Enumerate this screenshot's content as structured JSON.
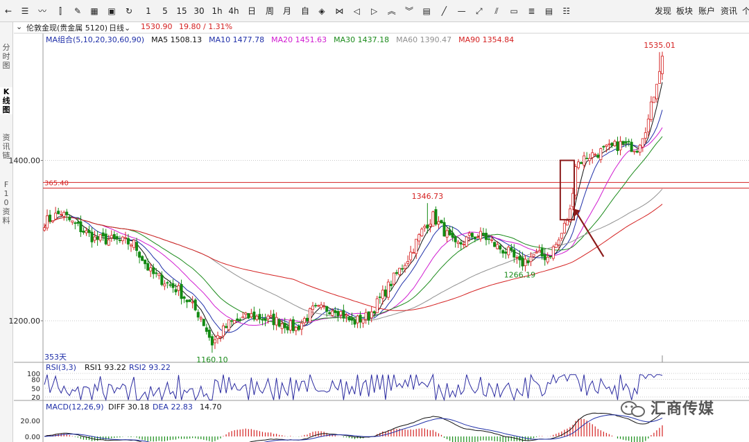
{
  "toolbar": {
    "left_icons": [
      "back-icon",
      "list-icon",
      "line-chart-icon",
      "candlestick-icon",
      "draw-icon",
      "grid-icon",
      "save-icon",
      "refresh-icon"
    ],
    "periods": [
      "1",
      "5",
      "15",
      "30",
      "1h",
      "4h",
      "日",
      "周",
      "月",
      "自"
    ],
    "tool_icons": [
      "diamond-icon",
      "bowtie-icon",
      "arrow-left-icon",
      "arrow-right-icon",
      "chevron-up-icon",
      "chevron-down-icon",
      "table-icon",
      "line-tool-icon",
      "hline-tool-icon",
      "ray-tool-icon",
      "parallel-tool-icon",
      "rect-tool-icon",
      "fib-tool-icon",
      "sheet-icon",
      "list-tool-icon"
    ],
    "right_links": [
      "发现",
      "板块",
      "账户",
      "资讯"
    ],
    "clipped": "个"
  },
  "sidebar": {
    "tabs": [
      "分时图",
      "K线图",
      "资讯链",
      "F10资料"
    ],
    "active": "K线图"
  },
  "info": {
    "name": "伦敦金现(贵金属 5120)",
    "period": "日线",
    "price": "1530.90",
    "change": "19.80 / 1.31%"
  },
  "ma_legend": [
    {
      "label": "MA组合(5,10,20,30,60,90)",
      "color": "#1f2fa8"
    },
    {
      "label": "MA5 1508.13",
      "color": "#111111"
    },
    {
      "label": "MA10 1477.78",
      "color": "#1f2fa8"
    },
    {
      "label": "MA20 1451.63",
      "color": "#d01ad0"
    },
    {
      "label": "MA30 1437.18",
      "color": "#1a8a1a"
    },
    {
      "label": "MA60 1390.47",
      "color": "#909090"
    },
    {
      "label": "MA90 1354.84",
      "color": "#d42020"
    }
  ],
  "chart_data": {
    "type": "candlestick",
    "y_ticks": [
      "1400.00",
      "1200.00"
    ],
    "ylim": [
      1150,
      1540
    ],
    "hlines": [
      1365.4,
      1372.5
    ],
    "hline_label": "365.40",
    "annotations": [
      {
        "text": "1535.01",
        "i": 220,
        "value": 1535.01,
        "color": "#d42020"
      },
      {
        "text": "1346.73",
        "i": 137,
        "value": 1346.73,
        "color": "#d42020"
      },
      {
        "text": "1266.19",
        "i": 170,
        "value": 1266.19,
        "color": "#1a8a1a"
      },
      {
        "text": "1160.10",
        "i": 60,
        "value": 1160.1,
        "color": "#1a8a1a"
      }
    ],
    "bar_count_label": "353天",
    "highlight_box": {
      "i0": 185,
      "i1": 189,
      "low": 1326,
      "high": 1400
    },
    "arrow": {
      "from_i": 200,
      "from_value": 1280,
      "to_i": 189,
      "to_value": 1340
    },
    "anchors": [
      [
        0,
        1323
      ],
      [
        6,
        1335
      ],
      [
        10,
        1322
      ],
      [
        18,
        1302
      ],
      [
        26,
        1300
      ],
      [
        32,
        1296
      ],
      [
        38,
        1260
      ],
      [
        48,
        1238
      ],
      [
        56,
        1205
      ],
      [
        60,
        1172
      ],
      [
        66,
        1196
      ],
      [
        74,
        1206
      ],
      [
        84,
        1199
      ],
      [
        90,
        1190
      ],
      [
        96,
        1213
      ],
      [
        104,
        1216
      ],
      [
        110,
        1198
      ],
      [
        116,
        1206
      ],
      [
        124,
        1248
      ],
      [
        130,
        1278
      ],
      [
        136,
        1318
      ],
      [
        139,
        1330
      ],
      [
        143,
        1312
      ],
      [
        147,
        1292
      ],
      [
        153,
        1306
      ],
      [
        157,
        1306
      ],
      [
        162,
        1292
      ],
      [
        166,
        1285
      ],
      [
        170,
        1270
      ],
      [
        175,
        1282
      ],
      [
        180,
        1280
      ],
      [
        184,
        1300
      ],
      [
        188,
        1336
      ],
      [
        190,
        1395
      ],
      [
        194,
        1405
      ],
      [
        200,
        1412
      ],
      [
        206,
        1420
      ],
      [
        212,
        1416
      ],
      [
        216,
        1450
      ],
      [
        219,
        1500
      ],
      [
        221,
        1530
      ]
    ],
    "rsi": {
      "label": "RSI(3,3)",
      "rsi1": "RSI1 93.22",
      "rsi2": "RSI2 93.22",
      "ticks": [
        "100",
        "80",
        "50",
        "20"
      ]
    },
    "macd": {
      "label": "MACD(12,26,9)",
      "diff": "DIFF 30.18",
      "dea": "DEA 22.83",
      "val": "14.70",
      "ticks": [
        "20.00",
        "0.00"
      ]
    }
  },
  "watermark": "汇商传媒"
}
